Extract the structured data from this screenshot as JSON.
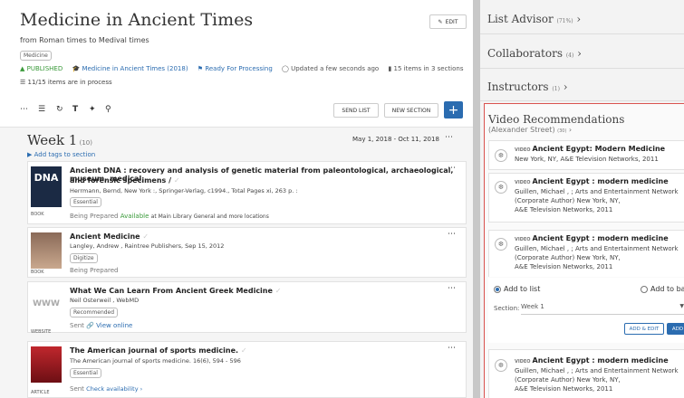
{
  "header": {
    "title": "Medicine in Ancient Times",
    "subtitle": "from Roman times to Medival times",
    "tag": "Medicine",
    "edit_label": "EDIT",
    "published": "PUBLISHED",
    "course": "Medicine in Ancient Times (2018)",
    "processing": "Ready For Processing",
    "updated": "Updated a few seconds ago",
    "items_count": "15 items in 3 sections",
    "progress": "11/15 items are in process"
  },
  "toolbar": {
    "send_list": "SEND LIST",
    "new_section": "NEW SECTION",
    "add": "+"
  },
  "week": {
    "title": "Week 1",
    "count": "(10)",
    "dates": "May 1, 2018 - Oct 11, 2018",
    "add_tags": "Add tags to section"
  },
  "items": [
    {
      "title": "Ancient DNA : recovery and analysis of genetic material from paleontological, archaeological, museum, medical,",
      "title2": "and forensic specimens /",
      "meta": "Herrmann, Bernd, New York :, Springer-Verlag, c1994., Total Pages xi, 263 p. :",
      "tag": "Essential",
      "status": "Being Prepared",
      "avail": "Available",
      "avail_rest": "at Main Library General and more locations",
      "type": "BOOK",
      "thumb_text": "DNA"
    },
    {
      "title": "Ancient Medicine",
      "meta": "Langley, Andrew , Raintree Publishers, Sep 15, 2012",
      "tag": "Digitize",
      "status": "Being Prepared",
      "type": "BOOK"
    },
    {
      "title": "What We Can Learn From Ancient Greek Medicine",
      "meta": "Neil Osterweil , WebMD",
      "tag": "Recommended",
      "status": "Sent",
      "link": "View online",
      "type": "WEBSITE",
      "thumb_text": "WWW"
    },
    {
      "title": "The American journal of sports medicine.",
      "meta": "The American journal of sports medicine. 16(6), 594 - 596",
      "tag": "Essential",
      "status": "Sent",
      "link": "Check availability",
      "type": "ARTICLE"
    }
  ],
  "right": {
    "list_advisor": "List Advisor",
    "list_advisor_pct": "(71%)",
    "collaborators": "Collaborators",
    "collaborators_count": "(4)",
    "instructors": "Instructors",
    "instructors_count": "(1)",
    "vr_title": "Video Recommendations",
    "vr_sub": "(Alexander Street)",
    "vr_count": "(30)",
    "type_label": "VIDEO",
    "recs": [
      {
        "title": "Ancient Egypt: Modern Medicine",
        "meta1": "New York, NY, A&E Television Networks, 2011",
        "meta2": "",
        "meta3": ""
      },
      {
        "title": "Ancient Egypt : modern medicine",
        "meta1": "Guillen, Michael , ; Arts and Entertainment Network",
        "meta2": "(Corporate Author) New York, NY,",
        "meta3": "A&E Television Networks, 2011"
      },
      {
        "title": "Ancient Egypt : modern medicine",
        "meta1": "Guillen, Michael , ; Arts and Entertainment Network",
        "meta2": "(Corporate Author) New York, NY,",
        "meta3": "A&E Television Networks, 2011"
      },
      {
        "title": "Ancient Egypt : modern medicine",
        "meta1": "Guillen, Michael , ; Arts and Entertainment Network",
        "meta2": "(Corporate Author) New York, NY,",
        "meta3": "A&E Television Networks, 2011"
      }
    ],
    "add_to_list": "Add to list",
    "add_to_bag": "Add to bag",
    "section_label": "Section:",
    "section_value": "Week 1",
    "add_edit": "ADD & EDIT",
    "add": "ADD"
  }
}
